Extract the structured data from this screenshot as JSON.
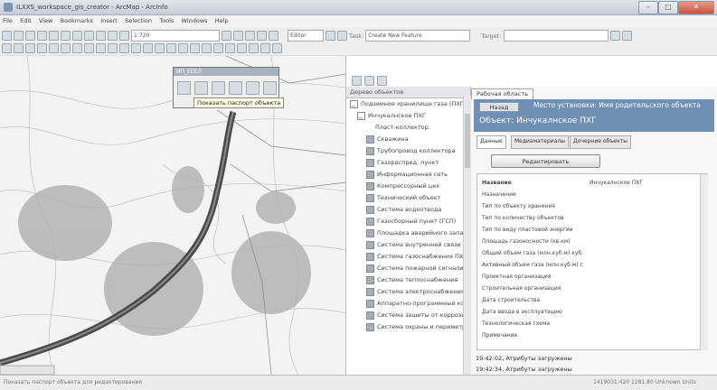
{
  "window": {
    "title": "ILXXS_workspace_gis_creator - ArcMap - ArcInfo"
  },
  "menus": [
    "File",
    "Edit",
    "View",
    "Bookmarks",
    "Insert",
    "Selection",
    "Tools",
    "Windows",
    "Help"
  ],
  "toolbar": {
    "scale_value": "1:720",
    "editor_label": "Editor",
    "task_label": "Task:",
    "task_value": "Create New Feature",
    "target_label": "Target:"
  },
  "map_toolbox": {
    "title": "ИП_ЕЕЕЛ",
    "tooltip": "Показать паспорт объекта"
  },
  "tree": {
    "header": "Дерево объектов",
    "items": [
      "Подземное хранилище газа (ПХГ)",
      "Инчукалнское ПХГ",
      "Пласт-коллектор",
      "Скважина",
      "Трубопровод коллектора",
      "Газораспред. пункт",
      "Информационная сеть",
      "Компрессорный цех",
      "Технический объект",
      "Система водоотвода",
      "Газосборный пункт (ГСП)",
      "Площадка аварийного запаса",
      "Система внутренней связи",
      "Система газоснабжения ПХГ",
      "Система пожарной сигнализации",
      "Система теплоснабжения",
      "Система электроснабжения",
      "Аппаратно-программный комплекс",
      "Система защиты от коррозии",
      "Система охраны и периметра"
    ]
  },
  "workarea": {
    "tab": "Рабочая область",
    "back_button": "Назад",
    "location_text": "Место установки: Имя родительского объекта",
    "object_title": "Объект: Инчукалнское ПХГ",
    "subtabs": [
      "Данные",
      "Медиаматериалы",
      "Дочерние объекты"
    ],
    "edit_button": "Редактировать",
    "attr_header": "Название",
    "attr_header_value": "Инчукалнское ПХГ",
    "attributes": [
      "Назначение",
      "Тип по объекту хранения",
      "Тип по количеству объектов",
      "Тип по виду пластовой энергии",
      "Площадь газоносности (кв.км)",
      "Общий объем газа (млн.куб.м) куб.",
      "Активный объем газа (млн.куб.м) с",
      "Проектная организация",
      "Строительная организация",
      "Дата строительства",
      "Дата ввода в эксплуатацию",
      "Технологическая схема",
      "Примечание"
    ],
    "log": [
      "19:42:02, Атрибуты загружены",
      "19:42:34, Атрибуты загружены"
    ]
  },
  "statusbar": {
    "left": "Показать паспорт объекта для редактирования",
    "right": "1419031.420 1281.80 Unknown Units"
  },
  "colors": {
    "accent_blue": "#6f8fb4",
    "title_bar": "#d3dbe4"
  }
}
